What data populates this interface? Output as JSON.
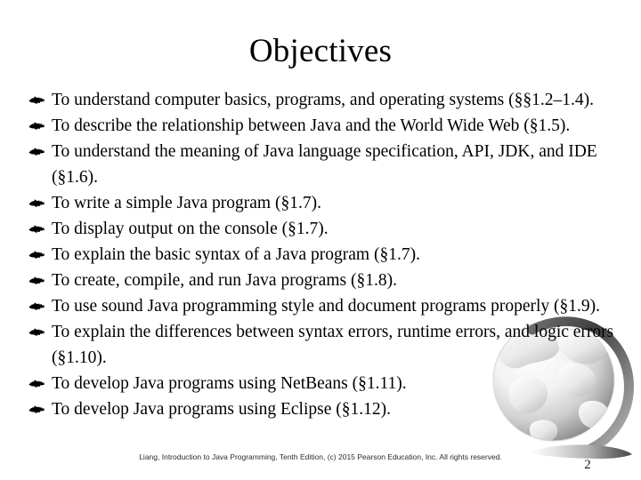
{
  "slide": {
    "title": "Objectives",
    "bullet_icon": "pointing-hand-icon",
    "bullet_glyph": "☞",
    "page_number": "2",
    "footer": "Liang, Introduction to Java Programming, Tenth Edition, (c) 2015 Pearson Education, Inc. All rights reserved.",
    "decorations": {
      "globe": "globe-watermark-icon",
      "swoosh": "swoosh-shape",
      "globe_color": "#9a9a9a",
      "arc_color": "#4d4d4d",
      "swoosh_color": "#5a5a5a"
    },
    "bullets": [
      {
        "text": "To understand computer basics, programs, and operating systems (§§1.2–1.4)."
      },
      {
        "text": "To describe the relationship between Java and the World Wide Web (§1.5)."
      },
      {
        "text": "To understand the meaning of Java language specification, API, JDK, and IDE (§1.6)."
      },
      {
        "text": "To write a simple Java program (§1.7)."
      },
      {
        "text": "To display output on the console (§1.7)."
      },
      {
        "text": "To explain the basic syntax of a Java program (§1.7)."
      },
      {
        "text": "To create, compile, and run Java programs (§1.8)."
      },
      {
        "text": "To use sound Java programming style and document programs properly (§1.9)."
      },
      {
        "text": "To explain the differences between syntax errors, runtime errors, and logic errors (§1.10)."
      },
      {
        "text": "To develop Java programs using NetBeans (§1.11)."
      },
      {
        "text": "To develop Java programs using Eclipse (§1.12)."
      }
    ]
  }
}
